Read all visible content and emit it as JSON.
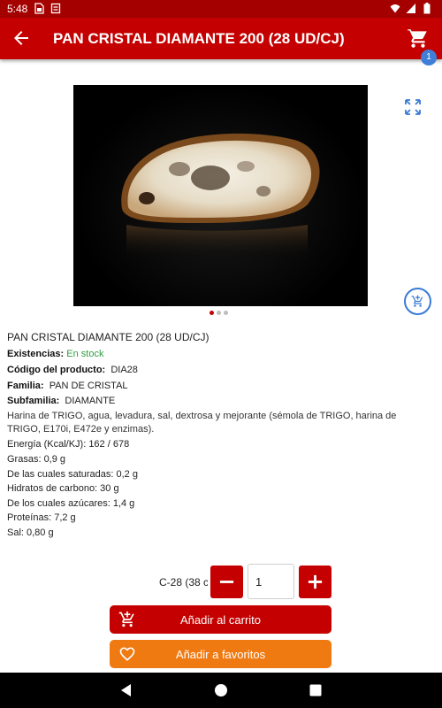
{
  "status_bar": {
    "time": "5:48",
    "icons": [
      "sim-card-icon",
      "storage-icon",
      "wifi-icon",
      "signal-icon",
      "battery-icon"
    ]
  },
  "app_bar": {
    "title": "PAN CRISTAL DIAMANTE 200 (28 UD/CJ)",
    "cart_count": "1",
    "colors": {
      "bar": "#c40000",
      "status": "#a50000",
      "badge": "#3f7fd8"
    }
  },
  "product": {
    "image_alt": "bread-slice-photo",
    "carousel": {
      "count": 3,
      "active": 0
    },
    "name": "PAN CRISTAL DIAMANTE 200 (28 UD/CJ)",
    "stock_label": "Existencias:",
    "stock_value": "En stock",
    "code_label": "Código del producto:",
    "code_value": "DIA28",
    "family_label": "Familia:",
    "family_value": "PAN DE CRISTAL",
    "subfamily_label": "Subfamilia:",
    "subfamily_value": "DIAMANTE",
    "ingredients": "Harina de TRIGO, agua, levadura, sal, dextrosa y mejorante (sémola de TRIGO, harina de TRIGO, E170i, E472e y enzimas).",
    "nutrition": [
      "Energía (Kcal/KJ): 162 / 678",
      "Grasas: 0,9 g",
      "De las cuales saturadas: 0,2 g",
      "Hidratos de carbono: 30 g",
      "De los cuales azúcares: 1,4 g",
      "Proteínas: 7,2 g",
      "Sal: 0,80 g"
    ]
  },
  "order": {
    "unit_label": "C-28 (38 c",
    "quantity": "1",
    "add_to_cart": "Añadir al carrito",
    "add_to_favorites": "Añadir a favoritos",
    "colors": {
      "cart_button": "#c40000",
      "favorites_button": "#f07a12"
    }
  }
}
